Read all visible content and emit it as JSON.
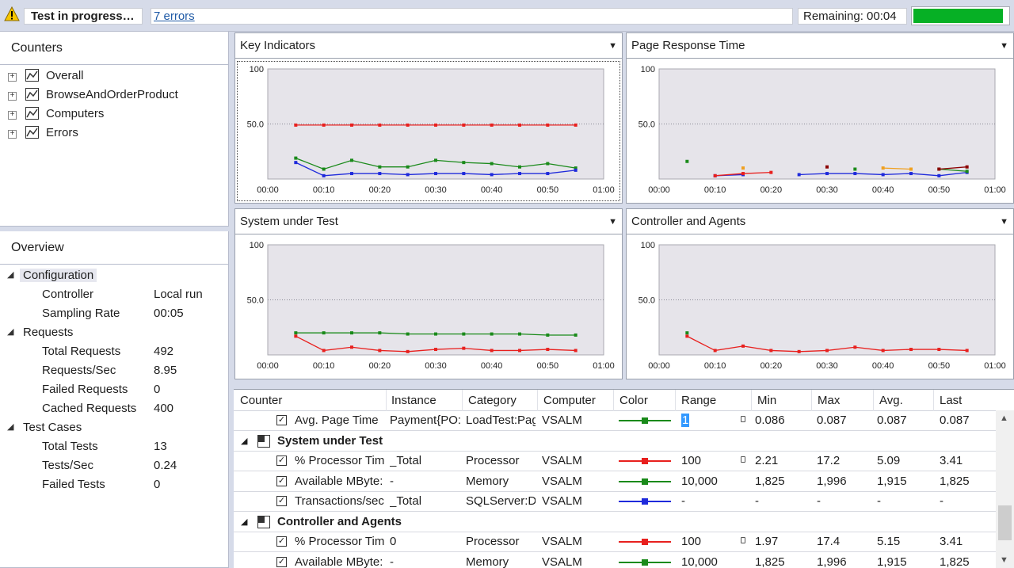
{
  "status": {
    "text": "Test in progress…",
    "errors_link": "7 errors",
    "remaining_label": "Remaining:",
    "remaining_value": "00:04",
    "progress_fraction": 0.95,
    "progress_color": "#06b025"
  },
  "counters_panel": {
    "title": "Counters",
    "items": [
      {
        "label": "Overall"
      },
      {
        "label": "BrowseAndOrderProduct"
      },
      {
        "label": "Computers"
      },
      {
        "label": "Errors"
      }
    ]
  },
  "overview_panel": {
    "title": "Overview",
    "groups": [
      {
        "label": "Configuration",
        "rows": [
          {
            "key": "Controller",
            "value": "Local run"
          },
          {
            "key": "Sampling Rate",
            "value": "00:05"
          }
        ]
      },
      {
        "label": "Requests",
        "rows": [
          {
            "key": "Total Requests",
            "value": "492"
          },
          {
            "key": "Requests/Sec",
            "value": "8.95"
          },
          {
            "key": "Failed Requests",
            "value": "0"
          },
          {
            "key": "Cached Requests",
            "value": "400"
          }
        ]
      },
      {
        "label": "Test Cases",
        "rows": [
          {
            "key": "Total Tests",
            "value": "13"
          },
          {
            "key": "Tests/Sec",
            "value": "0.24"
          },
          {
            "key": "Failed Tests",
            "value": "0"
          }
        ]
      }
    ]
  },
  "graphs": [
    {
      "title": "Key Indicators"
    },
    {
      "title": "Page Response Time"
    },
    {
      "title": "System under Test"
    },
    {
      "title": "Controller and Agents"
    }
  ],
  "chart_data": [
    {
      "type": "line",
      "title": "Key Indicators",
      "ylim": [
        0,
        100
      ],
      "yticks": [
        "100",
        "50.0"
      ],
      "xticks": [
        "00:00",
        "00:10",
        "00:20",
        "00:30",
        "00:40",
        "00:50",
        "01:00"
      ],
      "x": [
        5,
        10,
        15,
        20,
        25,
        30,
        35,
        40,
        45,
        50,
        55
      ],
      "series": [
        {
          "color": "#e8201e",
          "values": [
            49,
            49,
            49,
            49,
            49,
            49,
            49,
            49,
            49,
            49,
            49
          ]
        },
        {
          "color": "#1a8a1a",
          "values": [
            19,
            9,
            17,
            11,
            11,
            17,
            15,
            14,
            11,
            14,
            10
          ]
        },
        {
          "color": "#1f2adb",
          "values": [
            15,
            3,
            5,
            5,
            4,
            5,
            5,
            4,
            5,
            5,
            8
          ]
        }
      ]
    },
    {
      "type": "line",
      "title": "Page Response Time",
      "ylim": [
        0,
        100
      ],
      "yticks": [
        "100",
        "50.0"
      ],
      "xticks": [
        "00:00",
        "00:10",
        "00:20",
        "00:30",
        "00:40",
        "00:50",
        "01:00"
      ],
      "x": [
        5,
        10,
        15,
        20,
        25,
        30,
        35,
        40,
        45,
        50,
        55
      ],
      "series": [
        {
          "color": "#1f2adb",
          "values": [
            null,
            3,
            4,
            null,
            4,
            5,
            5,
            4,
            5,
            3,
            6
          ]
        },
        {
          "color": "#e8201e",
          "values": [
            null,
            3,
            5,
            6,
            null,
            null,
            null,
            null,
            null,
            null,
            null
          ]
        },
        {
          "color": "#f0a020",
          "values": [
            null,
            null,
            10,
            null,
            null,
            null,
            null,
            10,
            9,
            null,
            null
          ]
        },
        {
          "color": "#1a8a1a",
          "values": [
            16,
            null,
            null,
            null,
            null,
            null,
            9,
            null,
            null,
            9,
            7
          ]
        },
        {
          "color": "#8b0000",
          "values": [
            null,
            null,
            null,
            null,
            null,
            11,
            null,
            null,
            null,
            9,
            11
          ]
        }
      ]
    },
    {
      "type": "line",
      "title": "System under Test",
      "ylim": [
        0,
        100
      ],
      "yticks": [
        "100",
        "50.0"
      ],
      "xticks": [
        "00:00",
        "00:10",
        "00:20",
        "00:30",
        "00:40",
        "00:50",
        "01:00"
      ],
      "x": [
        5,
        10,
        15,
        20,
        25,
        30,
        35,
        40,
        45,
        50,
        55
      ],
      "series": [
        {
          "color": "#1a8a1a",
          "values": [
            20,
            20,
            20,
            20,
            19,
            19,
            19,
            19,
            19,
            18,
            18
          ]
        },
        {
          "color": "#e8201e",
          "values": [
            17,
            4,
            7,
            4,
            3,
            5,
            6,
            4,
            4,
            5,
            4
          ]
        }
      ]
    },
    {
      "type": "line",
      "title": "Controller and Agents",
      "ylim": [
        0,
        100
      ],
      "yticks": [
        "100",
        "50.0"
      ],
      "xticks": [
        "00:00",
        "00:10",
        "00:20",
        "00:30",
        "00:40",
        "00:50",
        "01:00"
      ],
      "x": [
        5,
        10,
        15,
        20,
        25,
        30,
        35,
        40,
        45,
        50,
        55
      ],
      "series": [
        {
          "color": "#e8201e",
          "values": [
            17,
            4,
            8,
            4,
            3,
            4,
            7,
            4,
            5,
            5,
            4
          ]
        },
        {
          "color": "#1a8a1a",
          "values": [
            20,
            null,
            null,
            null,
            null,
            null,
            null,
            null,
            null,
            null,
            null
          ]
        }
      ]
    }
  ],
  "table": {
    "columns": [
      "Counter",
      "Instance",
      "Category",
      "Computer",
      "Color",
      "Range",
      "Min",
      "Max",
      "Avg.",
      "Last"
    ],
    "rows": [
      {
        "kind": "counter",
        "counter": "Avg. Page Time",
        "instance": "Payment{PO:",
        "category": "LoadTest:Pag",
        "computer": "VSALM",
        "color": "#1a8a1a",
        "range": "1",
        "range_selected": true,
        "locked": true,
        "min": "0.086",
        "max": "0.087",
        "avg": "0.087",
        "last": "0.087"
      },
      {
        "kind": "group",
        "label": "System under Test"
      },
      {
        "kind": "counter",
        "counter": "% Processor Tim",
        "instance": "_Total",
        "category": "Processor",
        "computer": "VSALM",
        "color": "#e8201e",
        "range": "100",
        "locked": true,
        "min": "2.21",
        "max": "17.2",
        "avg": "5.09",
        "last": "3.41"
      },
      {
        "kind": "counter",
        "counter": "Available MByte:",
        "instance": "-",
        "category": "Memory",
        "computer": "VSALM",
        "color": "#1a8a1a",
        "range": "10,000",
        "locked": false,
        "min": "1,825",
        "max": "1,996",
        "avg": "1,915",
        "last": "1,825"
      },
      {
        "kind": "counter",
        "counter": "Transactions/sec",
        "instance": "_Total",
        "category": "SQLServer:Da",
        "computer": "VSALM",
        "color": "#1f2adb",
        "range": "-",
        "locked": false,
        "min": "-",
        "max": "-",
        "avg": "-",
        "last": "-"
      },
      {
        "kind": "group",
        "label": "Controller and Agents"
      },
      {
        "kind": "counter",
        "counter": "% Processor Tim",
        "instance": "0",
        "category": "Processor",
        "computer": "VSALM",
        "color": "#e8201e",
        "range": "100",
        "locked": true,
        "min": "1.97",
        "max": "17.4",
        "avg": "5.15",
        "last": "3.41"
      },
      {
        "kind": "counter",
        "counter": "Available MByte:",
        "instance": "-",
        "category": "Memory",
        "computer": "VSALM",
        "color": "#1a8a1a",
        "range": "10,000",
        "locked": false,
        "min": "1,825",
        "max": "1,996",
        "avg": "1,915",
        "last": "1,825"
      }
    ]
  }
}
